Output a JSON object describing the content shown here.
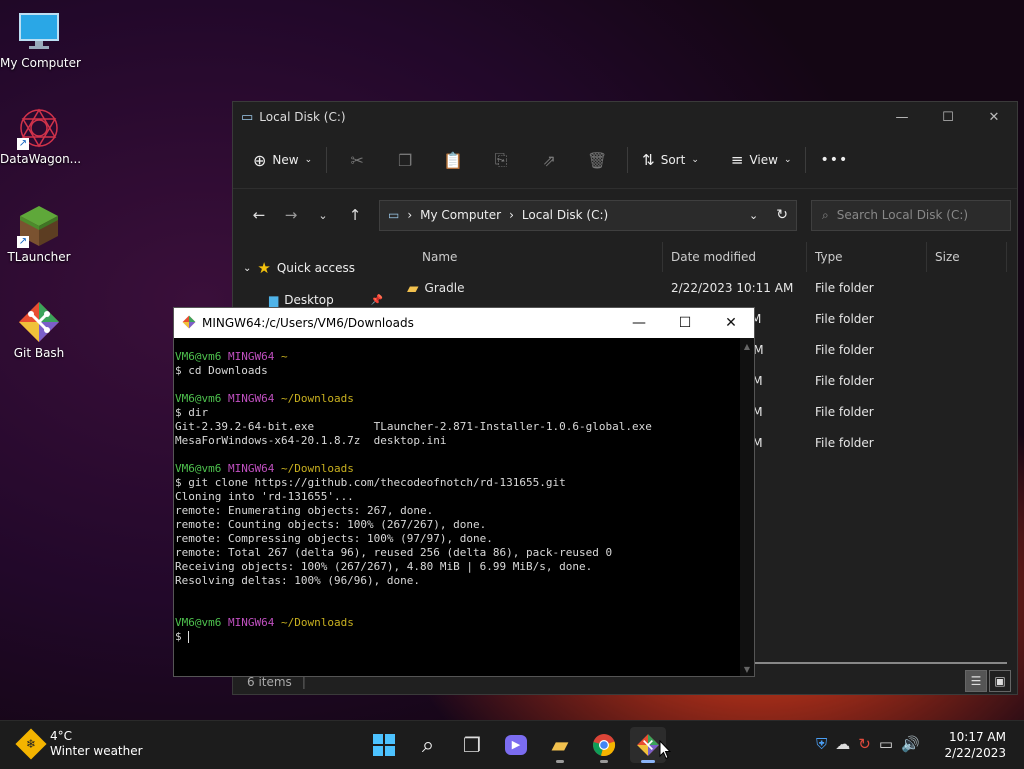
{
  "desktop": {
    "icons": [
      {
        "label": "My Computer"
      },
      {
        "label": "DataWagon..."
      },
      {
        "label": "TLauncher"
      },
      {
        "label": "Git Bash"
      }
    ]
  },
  "explorer": {
    "title": "Local Disk (C:)",
    "toolbar": {
      "new_label": "New",
      "sort_label": "Sort",
      "view_label": "View",
      "more_label": "•••"
    },
    "address": {
      "crumbs": [
        "My Computer",
        "Local Disk (C:)"
      ]
    },
    "search_placeholder": "Search Local Disk (C:)",
    "sidebar": {
      "items": [
        {
          "label": "Quick access"
        },
        {
          "label": "Desktop"
        }
      ]
    },
    "columns": [
      "Name",
      "Date modified",
      "Type",
      "Size"
    ],
    "rows": [
      {
        "name": "Gradle",
        "date": "2/22/2023 10:11 AM",
        "type": "File folder",
        "size": ""
      },
      {
        "name": "",
        "date": "M",
        "type": "File folder",
        "size": ""
      },
      {
        "name": "",
        "date": "AM",
        "type": "File folder",
        "size": ""
      },
      {
        "name": "",
        "date": "PM",
        "type": "File folder",
        "size": ""
      },
      {
        "name": "",
        "date": "PM",
        "type": "File folder",
        "size": ""
      },
      {
        "name": "",
        "date": "PM",
        "type": "File folder",
        "size": ""
      }
    ],
    "status": "6 items"
  },
  "terminal": {
    "title": "MINGW64:/c/Users/VM6/Downloads",
    "prompt_user": "VM6@vm6",
    "prompt_host": "MINGW64",
    "blocks": [
      {
        "path": "~",
        "lines": [
          "$ cd Downloads"
        ]
      },
      {
        "path": "~/Downloads",
        "lines": [
          "$ dir",
          "Git-2.39.2-64-bit.exe         TLauncher-2.871-Installer-1.0.6-global.exe",
          "MesaForWindows-x64-20.1.8.7z  desktop.ini"
        ]
      },
      {
        "path": "~/Downloads",
        "lines": [
          "$ git clone https://github.com/thecodeofnotch/rd-131655.git",
          "Cloning into 'rd-131655'...",
          "remote: Enumerating objects: 267, done.",
          "remote: Counting objects: 100% (267/267), done.",
          "remote: Compressing objects: 100% (97/97), done.",
          "remote: Total 267 (delta 96), reused 256 (delta 86), pack-reused 0",
          "Receiving objects: 100% (267/267), 4.80 MiB | 6.99 MiB/s, done.",
          "Resolving deltas: 100% (96/96), done.",
          ""
        ]
      },
      {
        "path": "~/Downloads",
        "lines": [
          "$ "
        ]
      }
    ]
  },
  "taskbar": {
    "weather_temp": "4°C",
    "weather_desc": "Winter weather",
    "time": "10:17 AM",
    "date": "2/22/2023"
  }
}
